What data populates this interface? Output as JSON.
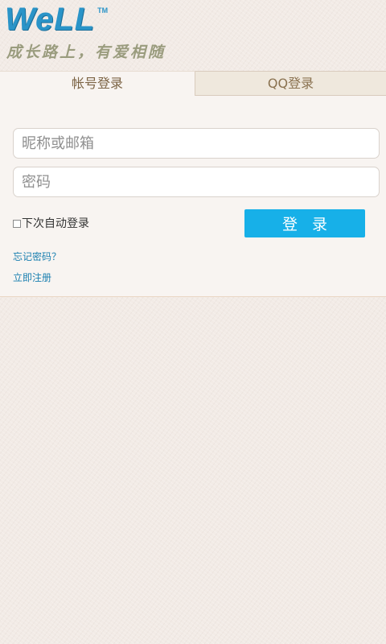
{
  "brand": {
    "logo_text": "WeLL",
    "trademark": "TM",
    "slogan": "成长路上，有爱相随"
  },
  "tabs": [
    {
      "label": "帐号登录",
      "active": true
    },
    {
      "label": "QQ登录",
      "active": false
    }
  ],
  "form": {
    "username_placeholder": "昵称或邮箱",
    "password_placeholder": "密码",
    "remember_label": "下次自动登录",
    "remember_checked": false,
    "login_label": "登 录"
  },
  "links": {
    "forgot_password": "忘记密码？",
    "register": "立即注册"
  },
  "colors": {
    "accent": "#17b0e8",
    "brand_blue": "#2a94c8",
    "link": "#1a7fb0",
    "tab_text": "#7c6445"
  }
}
